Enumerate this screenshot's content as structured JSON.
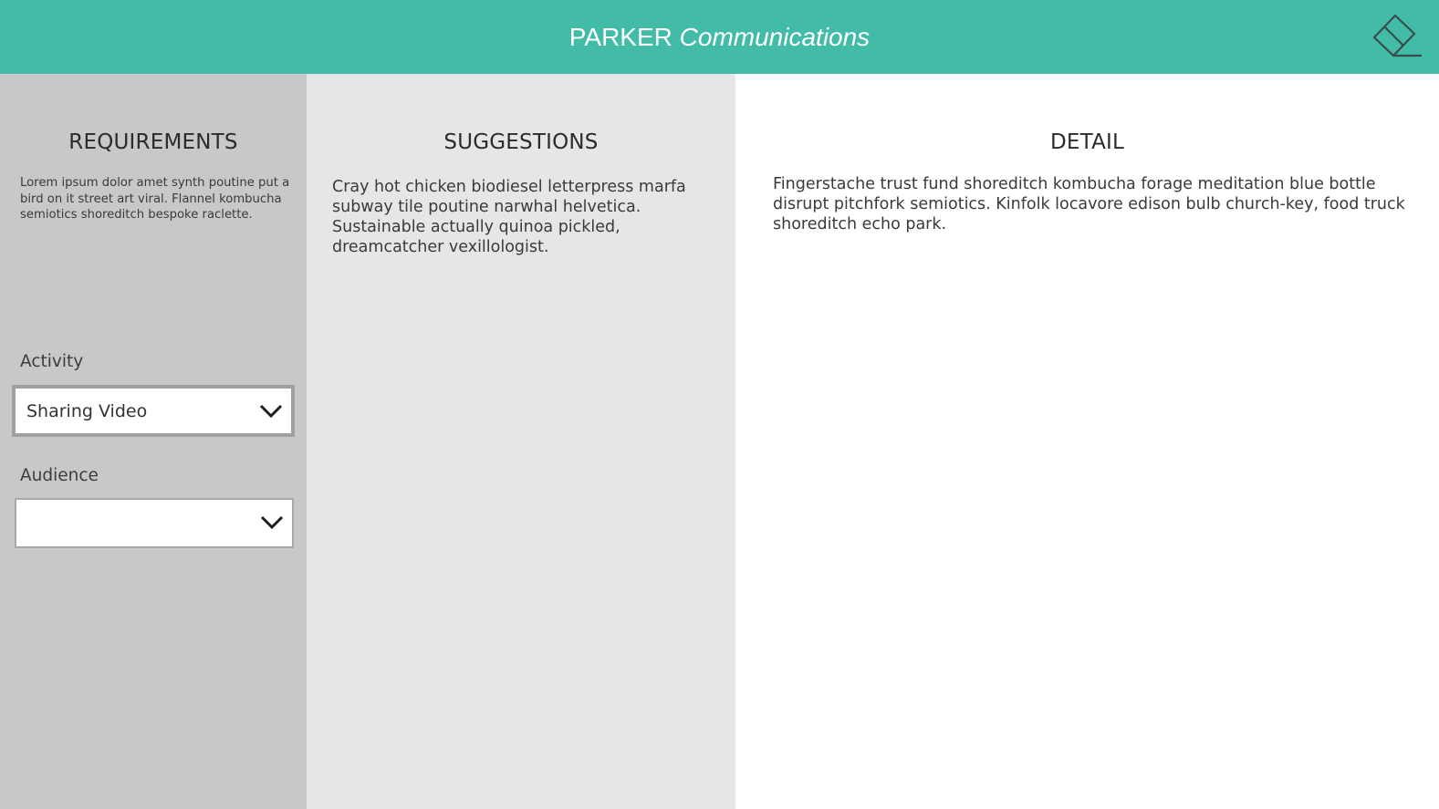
{
  "header": {
    "title_plain": "PARKER",
    "title_italic": "Communications",
    "clear_icon": "eraser-icon"
  },
  "colors": {
    "header_bg": "#42bca8",
    "requirements_bg": "#c8c8c8",
    "suggestions_bg": "#e6e6e6",
    "detail_bg": "#ffffff"
  },
  "requirements": {
    "heading": "REQUIREMENTS",
    "body": "Lorem ipsum dolor amet synth poutine put a bird on it street art viral. Flannel kombucha semiotics shoreditch bespoke raclette.",
    "activity": {
      "label": "Activity",
      "value": "Sharing Video",
      "icon": "chevron-down-icon"
    },
    "audience": {
      "label": "Audience",
      "value": "",
      "icon": "chevron-down-icon"
    }
  },
  "suggestions": {
    "heading": "SUGGESTIONS",
    "body": "Cray hot chicken biodiesel letterpress marfa subway tile poutine narwhal helvetica. Sustainable actually quinoa pickled, dreamcatcher vexillologist."
  },
  "detail": {
    "heading": "DETAIL",
    "body": "Fingerstache trust fund shoreditch kombucha forage meditation blue bottle disrupt pitchfork semiotics. Kinfolk locavore edison bulb church-key, food truck shoreditch echo park."
  }
}
